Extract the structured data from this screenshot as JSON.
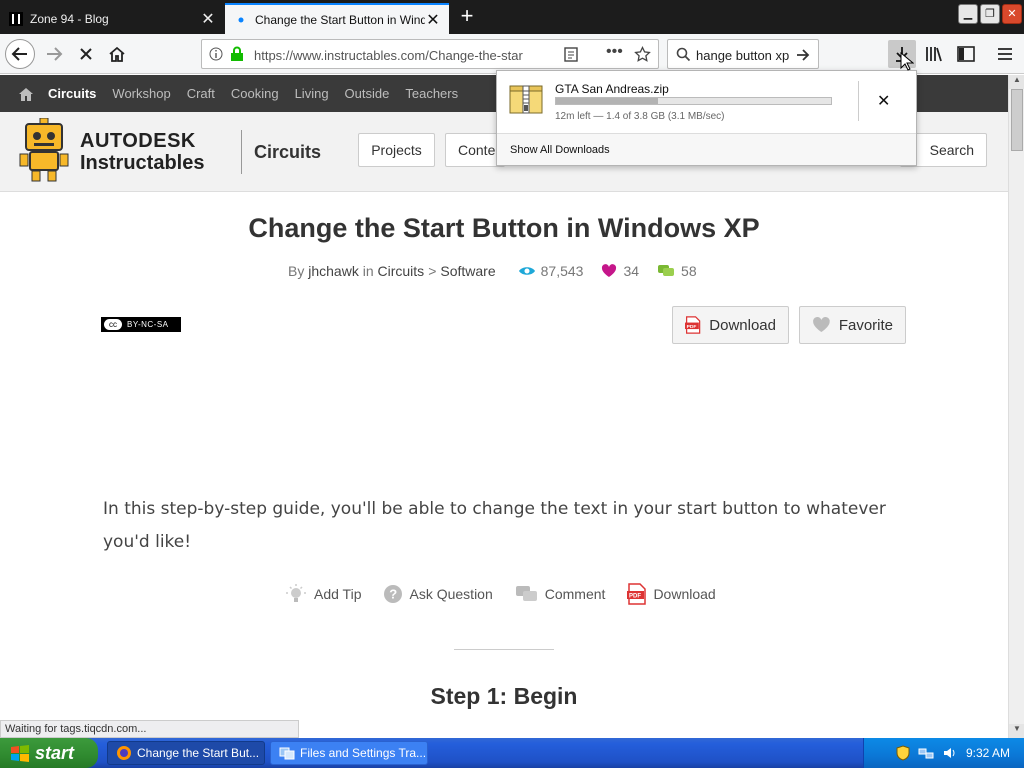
{
  "browser": {
    "tabs": [
      {
        "title": "Zone 94 - Blog",
        "active": false
      },
      {
        "title": "Change the Start Button in Windo",
        "active": true
      }
    ],
    "url": "https://www.instructables.com/Change-the-star",
    "search_value": "hange button xp"
  },
  "site": {
    "topnav": [
      "Circuits",
      "Workshop",
      "Craft",
      "Cooking",
      "Living",
      "Outside",
      "Teachers"
    ],
    "brand_line1": "AUTODESK",
    "brand_line2": "Instructables",
    "channel": "Circuits",
    "header_buttons": {
      "projects": "Projects",
      "contests": "Conte",
      "search": "Search"
    }
  },
  "article": {
    "title": "Change the Start Button in Windows XP",
    "by_label": "By",
    "author": "jhchawk",
    "in_label": "in",
    "category": "Circuits",
    "sep": ">",
    "subcategory": "Software",
    "views": "87,543",
    "favorites": "34",
    "comments": "58",
    "license": "BY-NC-SA",
    "download_label": "Download",
    "favorite_label": "Favorite",
    "intro": "In this step-by-step guide, you'll be able to change the text in your start button to whatever you'd like!",
    "actions": {
      "add_tip": "Add Tip",
      "ask_question": "Ask Question",
      "comment": "Comment",
      "download": "Download"
    },
    "step_title": "Step 1: Begin"
  },
  "downloads": {
    "filename": "GTA San Andreas.zip",
    "progress": 0.37,
    "status": "12m left — 1.4 of 3.8 GB (3.1 MB/sec)",
    "show_all": "Show All Downloads"
  },
  "status_text": "Waiting for tags.tiqcdn.com...",
  "taskbar": {
    "start": "start",
    "tasks": [
      "Change the Start But...",
      "Files and Settings Tra..."
    ],
    "clock": "9:32 AM"
  },
  "colors": {
    "accent": "#0a84ff",
    "views": "#1ea8d8",
    "heart": "#c5168a",
    "comment": "#7ab833",
    "pdf": "#d33"
  }
}
